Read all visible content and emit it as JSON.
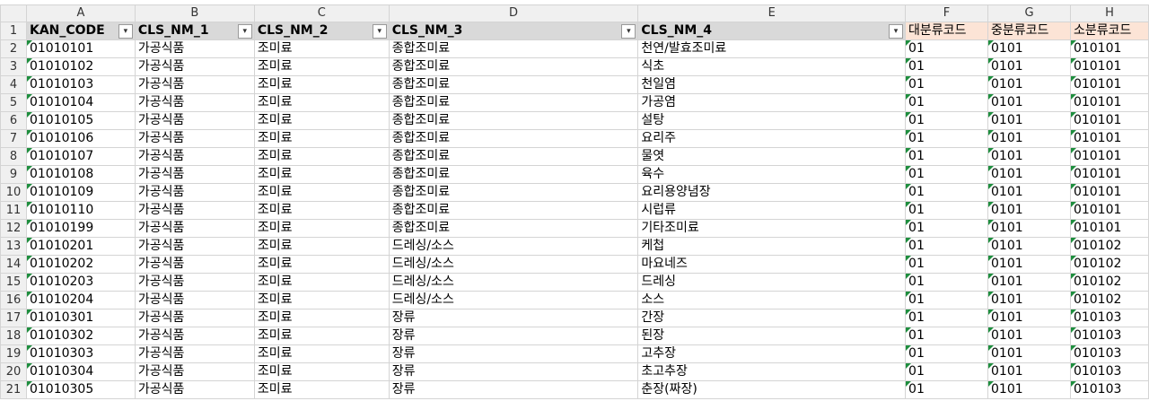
{
  "column_letters": [
    "A",
    "B",
    "C",
    "D",
    "E",
    "F",
    "G",
    "H"
  ],
  "headers": [
    "KAN_CODE",
    "CLS_NM_1",
    "CLS_NM_2",
    "CLS_NM_3",
    "CLS_NM_4",
    "대분류코드",
    "중분류코드",
    "소분류코드"
  ],
  "filter_glyph": "▾",
  "rows": [
    {
      "n": "2",
      "a": "01010101",
      "b": "가공식품",
      "c": "조미료",
      "d": "종합조미료",
      "e": "천연/발효조미료",
      "f": "01",
      "g": "0101",
      "h": "010101"
    },
    {
      "n": "3",
      "a": "01010102",
      "b": "가공식품",
      "c": "조미료",
      "d": "종합조미료",
      "e": "식초",
      "f": "01",
      "g": "0101",
      "h": "010101"
    },
    {
      "n": "4",
      "a": "01010103",
      "b": "가공식품",
      "c": "조미료",
      "d": "종합조미료",
      "e": "천일염",
      "f": "01",
      "g": "0101",
      "h": "010101"
    },
    {
      "n": "5",
      "a": "01010104",
      "b": "가공식품",
      "c": "조미료",
      "d": "종합조미료",
      "e": "가공염",
      "f": "01",
      "g": "0101",
      "h": "010101"
    },
    {
      "n": "6",
      "a": "01010105",
      "b": "가공식품",
      "c": "조미료",
      "d": "종합조미료",
      "e": "설탕",
      "f": "01",
      "g": "0101",
      "h": "010101"
    },
    {
      "n": "7",
      "a": "01010106",
      "b": "가공식품",
      "c": "조미료",
      "d": "종합조미료",
      "e": "요리주",
      "f": "01",
      "g": "0101",
      "h": "010101"
    },
    {
      "n": "8",
      "a": "01010107",
      "b": "가공식품",
      "c": "조미료",
      "d": "종합조미료",
      "e": "물엿",
      "f": "01",
      "g": "0101",
      "h": "010101"
    },
    {
      "n": "9",
      "a": "01010108",
      "b": "가공식품",
      "c": "조미료",
      "d": "종합조미료",
      "e": "육수",
      "f": "01",
      "g": "0101",
      "h": "010101"
    },
    {
      "n": "10",
      "a": "01010109",
      "b": "가공식품",
      "c": "조미료",
      "d": "종합조미료",
      "e": "요리용양념장",
      "f": "01",
      "g": "0101",
      "h": "010101"
    },
    {
      "n": "11",
      "a": "01010110",
      "b": "가공식품",
      "c": "조미료",
      "d": "종합조미료",
      "e": "시럽류",
      "f": "01",
      "g": "0101",
      "h": "010101"
    },
    {
      "n": "12",
      "a": "01010199",
      "b": "가공식품",
      "c": "조미료",
      "d": "종합조미료",
      "e": "기타조미료",
      "f": "01",
      "g": "0101",
      "h": "010101"
    },
    {
      "n": "13",
      "a": "01010201",
      "b": "가공식품",
      "c": "조미료",
      "d": "드레싱/소스",
      "e": "케첩",
      "f": "01",
      "g": "0101",
      "h": "010102"
    },
    {
      "n": "14",
      "a": "01010202",
      "b": "가공식품",
      "c": "조미료",
      "d": "드레싱/소스",
      "e": "마요네즈",
      "f": "01",
      "g": "0101",
      "h": "010102"
    },
    {
      "n": "15",
      "a": "01010203",
      "b": "가공식품",
      "c": "조미료",
      "d": "드레싱/소스",
      "e": "드레싱",
      "f": "01",
      "g": "0101",
      "h": "010102"
    },
    {
      "n": "16",
      "a": "01010204",
      "b": "가공식품",
      "c": "조미료",
      "d": "드레싱/소스",
      "e": "소스",
      "f": "01",
      "g": "0101",
      "h": "010102"
    },
    {
      "n": "17",
      "a": "01010301",
      "b": "가공식품",
      "c": "조미료",
      "d": "장류",
      "e": "간장",
      "f": "01",
      "g": "0101",
      "h": "010103"
    },
    {
      "n": "18",
      "a": "01010302",
      "b": "가공식품",
      "c": "조미료",
      "d": "장류",
      "e": "된장",
      "f": "01",
      "g": "0101",
      "h": "010103"
    },
    {
      "n": "19",
      "a": "01010303",
      "b": "가공식품",
      "c": "조미료",
      "d": "장류",
      "e": "고추장",
      "f": "01",
      "g": "0101",
      "h": "010103"
    },
    {
      "n": "20",
      "a": "01010304",
      "b": "가공식품",
      "c": "조미료",
      "d": "장류",
      "e": "초고추장",
      "f": "01",
      "g": "0101",
      "h": "010103"
    },
    {
      "n": "21",
      "a": "01010305",
      "b": "가공식품",
      "c": "조미료",
      "d": "장류",
      "e": "춘장(짜장)",
      "f": "01",
      "g": "0101",
      "h": "010103"
    }
  ]
}
